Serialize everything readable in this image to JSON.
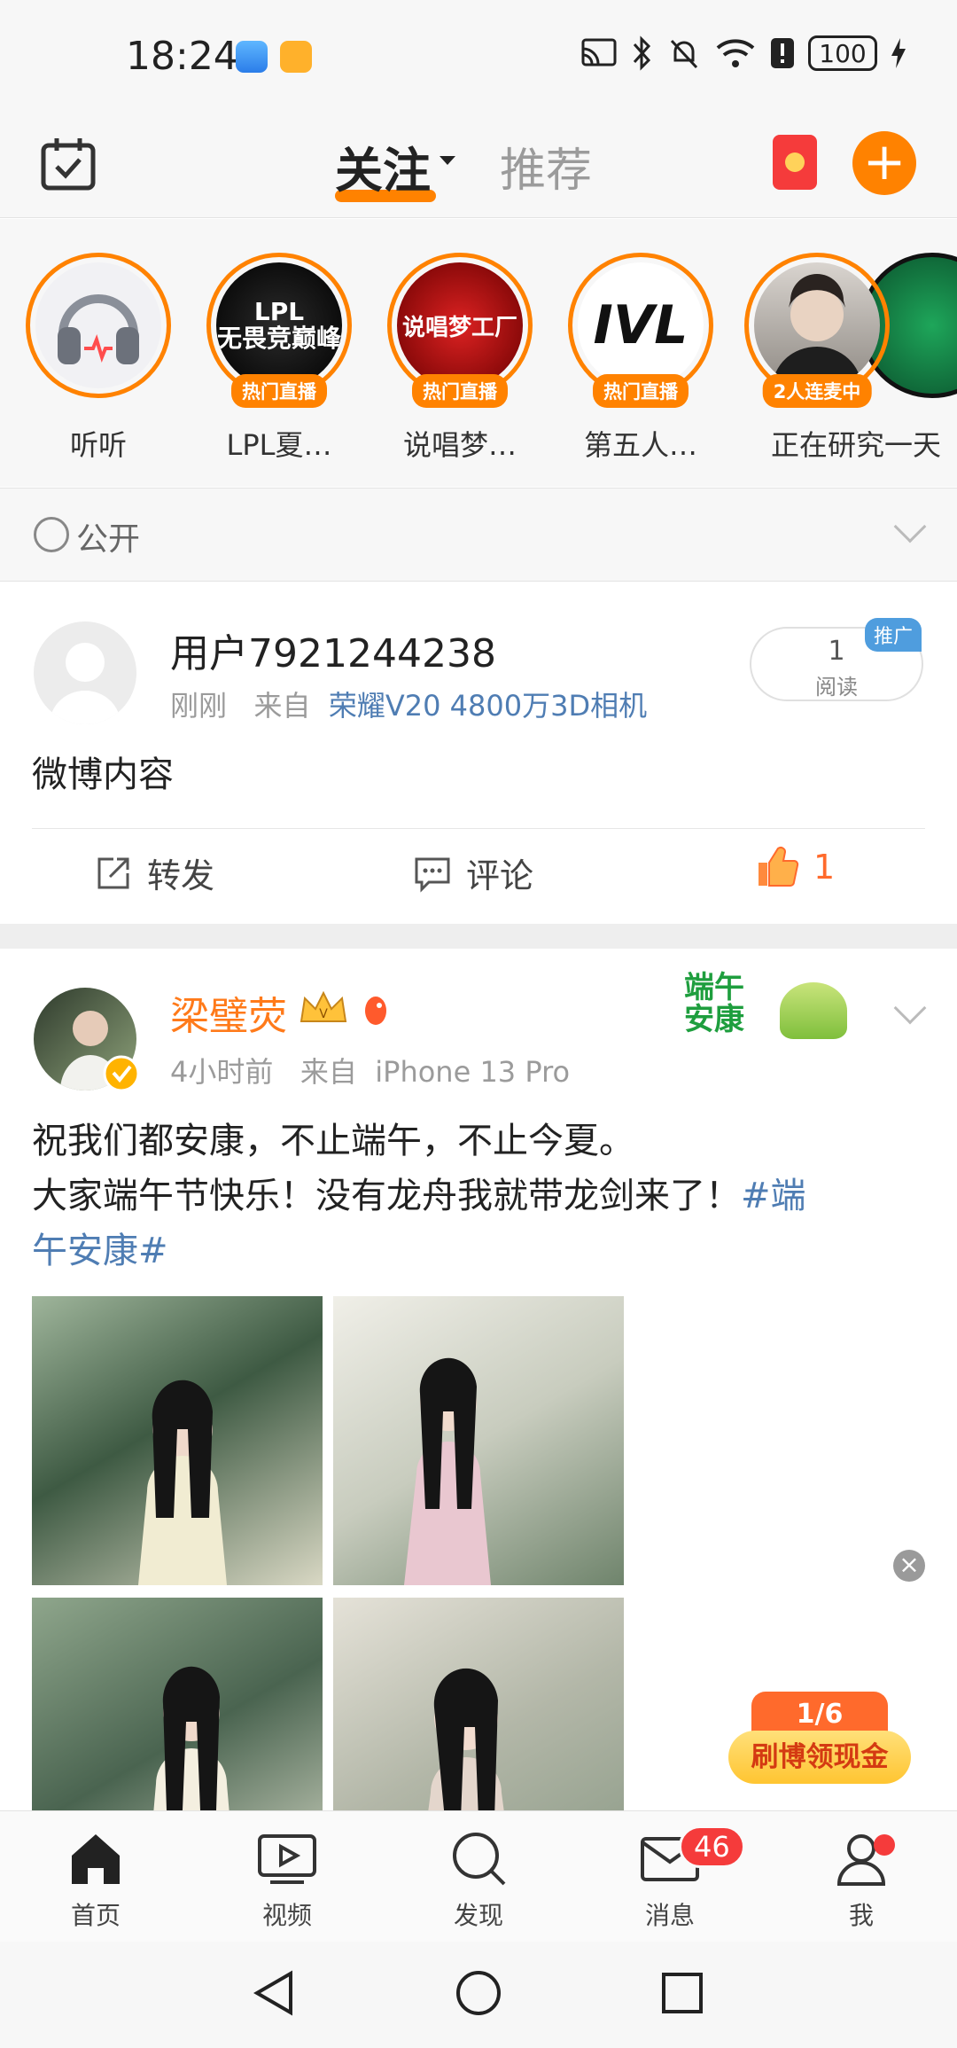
{
  "status_bar": {
    "time": "18:24",
    "battery": "100"
  },
  "header": {
    "tab_follow": "关注",
    "tab_recommend": "推荐"
  },
  "stories": [
    {
      "label": "听听",
      "badge": ""
    },
    {
      "label": "LPL夏…",
      "badge": "热门直播"
    },
    {
      "label": "说唱梦…",
      "badge": "热门直播"
    },
    {
      "label": "第五人…",
      "badge": "热门直播"
    },
    {
      "label": "正在研究一天",
      "badge": "2人连麦中"
    }
  ],
  "story_art": {
    "lpl": "LPL\n无畏竞巅峰",
    "rap": "说唱梦工厂",
    "ivl": "IVL"
  },
  "privacy": {
    "label": "公开"
  },
  "post1": {
    "username": "用户7921244238",
    "time": "刚刚",
    "from_prefix": "来自",
    "source": "荣耀V20 4800万3D相机",
    "content": "微博内容",
    "read_count": "1",
    "read_label": "阅读",
    "promo_tag": "推广",
    "repost_label": "转发",
    "comment_label": "评论",
    "like_count": "1"
  },
  "post2": {
    "username": "梁璧荧",
    "time": "4小时前",
    "from_prefix": "来自",
    "source": "iPhone 13 Pro",
    "line1": "祝我们都安康，不止端午，不止今夏。",
    "line2_text": "大家端午节快乐！没有龙舟我就带龙剑来了！",
    "hashtag_a": "#端",
    "hashtag_b": "午安康#",
    "sticker_text": "端午\n安康"
  },
  "cash_widget": {
    "progress": "1/6",
    "label": "刷博领现金"
  },
  "bottom_nav": [
    {
      "label": "首页"
    },
    {
      "label": "视频"
    },
    {
      "label": "发现"
    },
    {
      "label": "消息",
      "badge": "46"
    },
    {
      "label": "我"
    }
  ],
  "colors": {
    "accent": "#ff8200",
    "link": "#4f7db3",
    "badge_red": "#f53b3b"
  }
}
